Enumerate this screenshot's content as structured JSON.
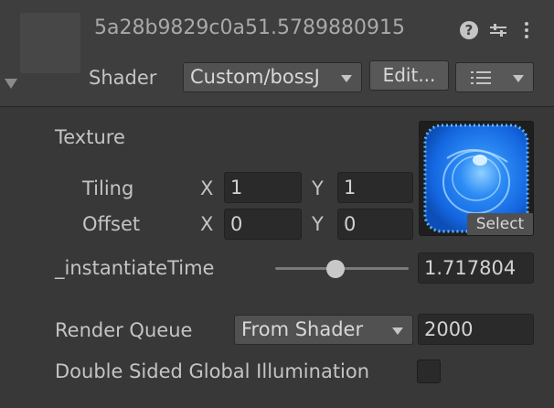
{
  "header": {
    "material_name": "5a28b9829c0a51.5789880915",
    "shader_label": "Shader",
    "shader_value": "Custom/bossJ",
    "edit_button": "Edit...",
    "icons": {
      "help": "help-icon",
      "preset": "preset-icon",
      "more": "kebab-menu-icon",
      "list": "list-icon"
    }
  },
  "texture": {
    "label": "Texture",
    "select_button": "Select",
    "tiling": {
      "label": "Tiling",
      "x_label": "X",
      "x": "1",
      "y_label": "Y",
      "y": "1"
    },
    "offset": {
      "label": "Offset",
      "x_label": "X",
      "x": "0",
      "y_label": "Y",
      "y": "0"
    }
  },
  "instantiate": {
    "label": "_instantiateTime",
    "value": "1.717804",
    "slider_fraction": 0.45
  },
  "render_queue": {
    "label": "Render Queue",
    "mode": "From Shader",
    "value": "2000"
  },
  "double_sided_gi": {
    "label": "Double Sided Global Illumination",
    "checked": false
  },
  "colors": {
    "background": "#383838",
    "field": "#2a2a2a",
    "text": "#c4c4c4",
    "texture_blue": "#1f7bf0"
  }
}
